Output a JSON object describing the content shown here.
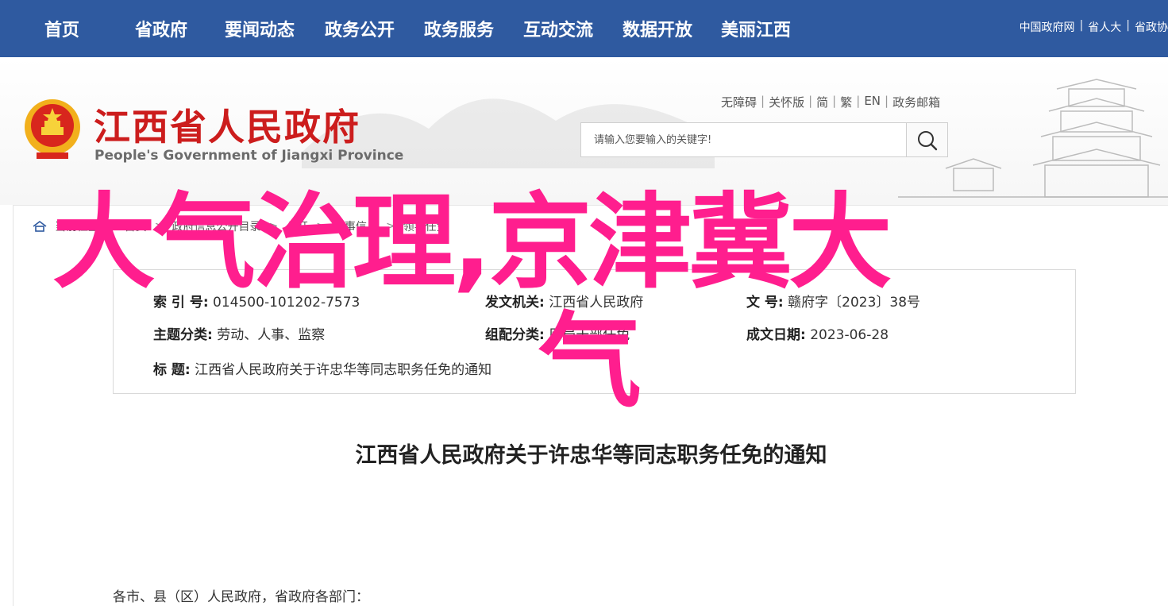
{
  "topnav": {
    "items": [
      "首页",
      "省政府",
      "要闻动态",
      "政务公开",
      "政务服务",
      "互动交流",
      "数据开放",
      "美丽江西"
    ],
    "links": [
      "中国政府网",
      "省人大",
      "省政协"
    ]
  },
  "header": {
    "title": "江西省人民政府",
    "subtitle": "People's Government of Jiangxi Province",
    "util_links": [
      "无障碍",
      "关怀版",
      "简",
      "繁",
      "EN",
      "政务邮箱"
    ],
    "search_placeholder": "请输入您要输入的关键字!"
  },
  "breadcrumb": {
    "label": "当前位置",
    "items": [
      "首页",
      "政府信息公开目录",
      "公开",
      "人事信息",
      "领导任免"
    ]
  },
  "meta": {
    "index_label": "索 引 号:",
    "index_value": "014500-101202-7573",
    "org_label": "发文机关:",
    "org_value": "江西省人民政府",
    "docno_label": "文 号:",
    "docno_value": "赣府字〔2023〕38号",
    "topic_label": "主题分类:",
    "topic_value": "劳动、人事、监察",
    "category_label": "组配分类:",
    "category_value": "厅局干部任免",
    "date_label": "成文日期:",
    "date_value": "2023-06-28",
    "title_label": "标 题:",
    "title_value": "江西省人民政府关于许忠华等同志职务任免的通知"
  },
  "document": {
    "title": "江西省人民政府关于许忠华等同志职务任免的通知",
    "salutation": "各市、县（区）人民政府，省政府各部门："
  },
  "overlay": {
    "line1": "大气治理,京津冀大",
    "line2": "气"
  },
  "colors": {
    "nav_bg": "#2f5aa0",
    "title_red": "#cc1d1d",
    "overlay_pink": "#ff1e8e"
  }
}
